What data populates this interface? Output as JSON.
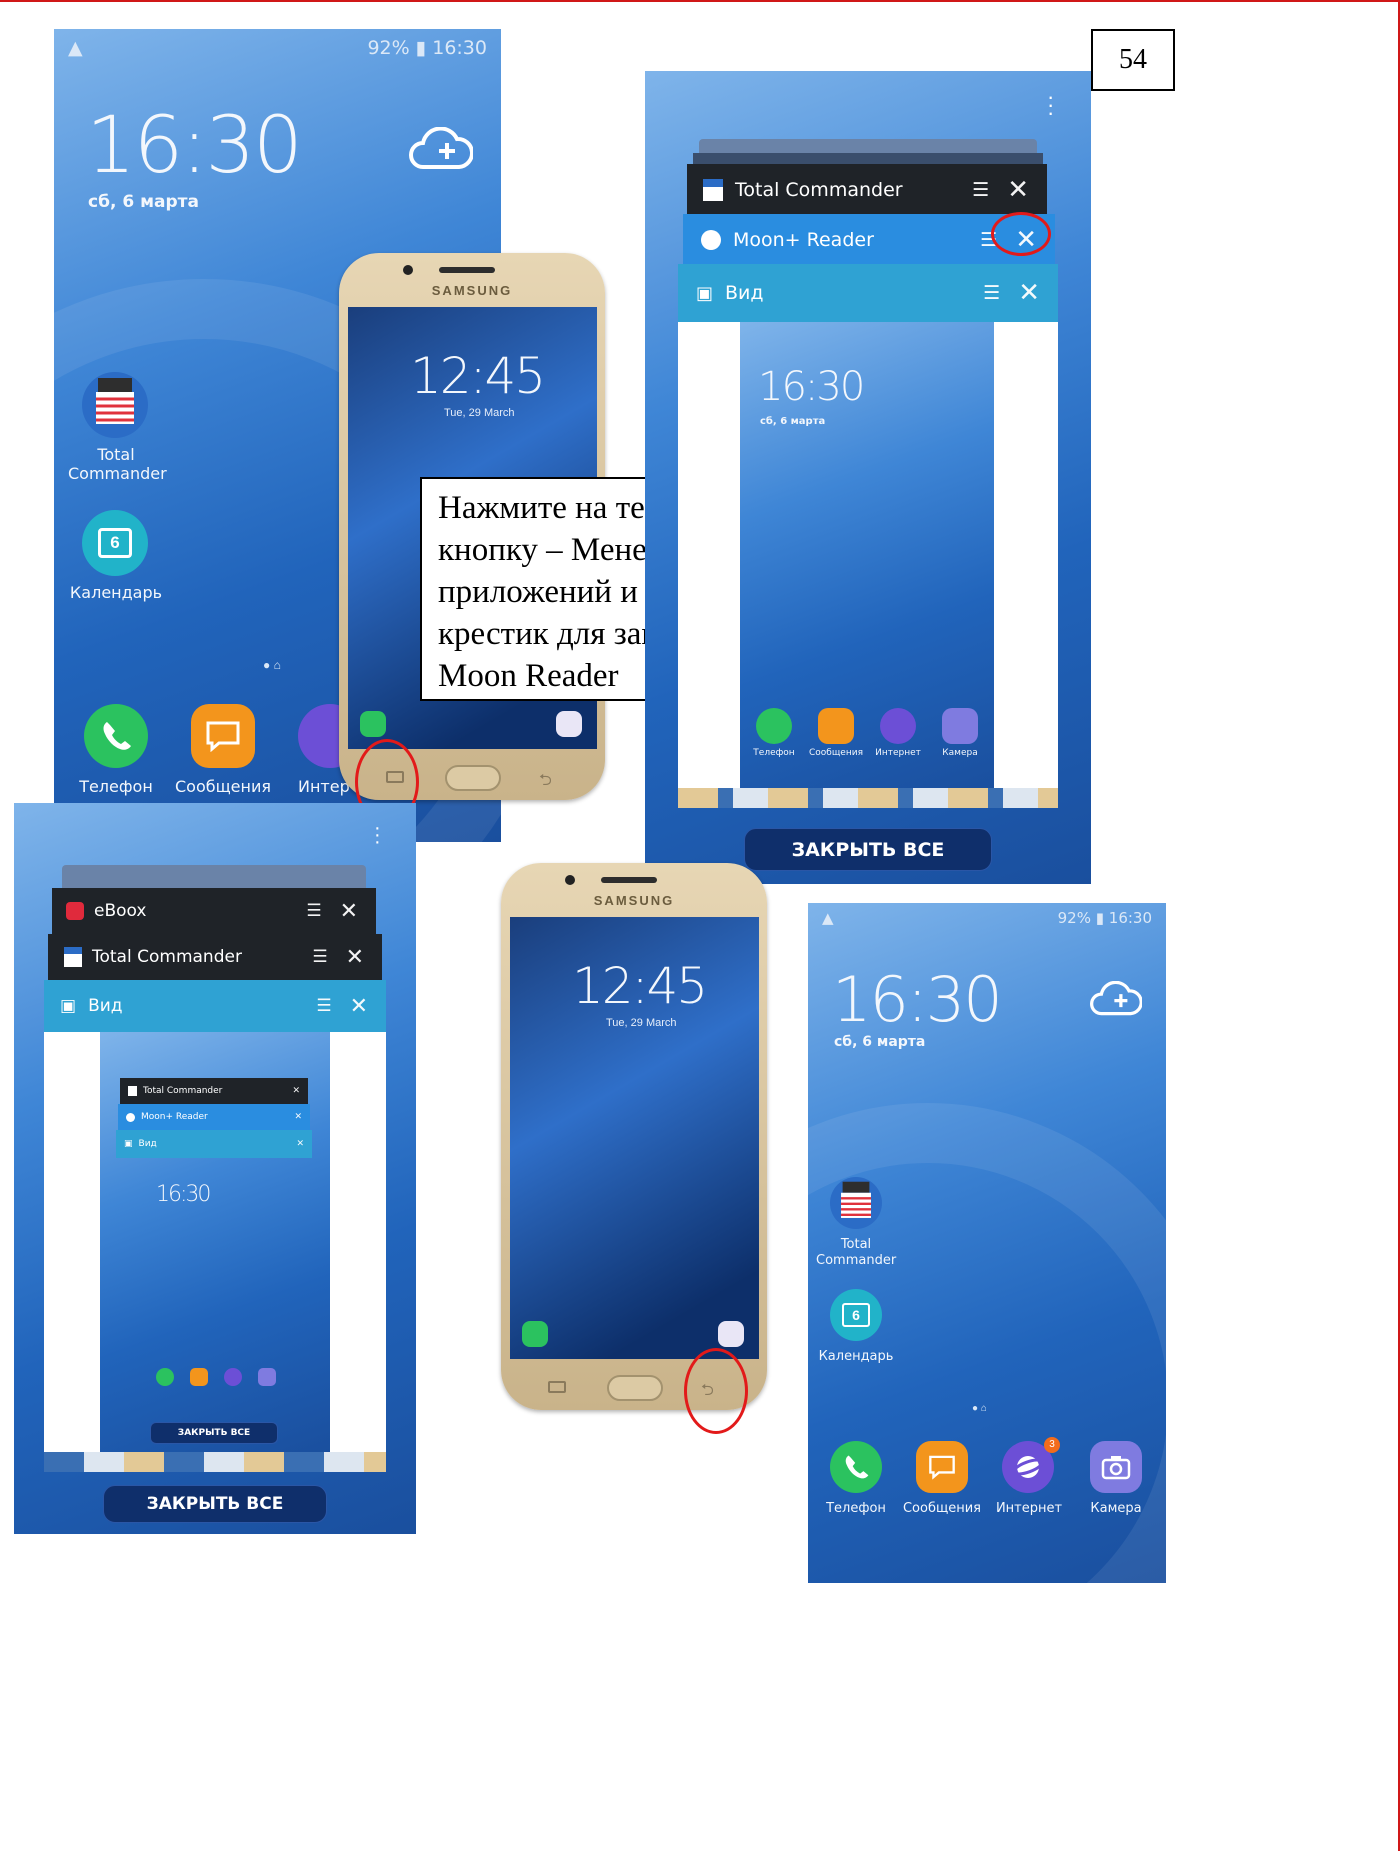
{
  "page_number": "54",
  "instruction": "Нажмите на телефоне кнопку – Менеджер приложений и нажмите на крестик для закрытия – Moon Reader",
  "status": {
    "right": "92% ▮ 16:30",
    "left": "▲"
  },
  "home": {
    "time": "16:30",
    "date": "сб, 6 марта",
    "apps": {
      "total_commander": "Total Commander",
      "calendar": "Календарь",
      "calendar_day": "6"
    },
    "dock": {
      "phone": "Телефон",
      "messages": "Сообщения",
      "internet": "Интернет",
      "internet_cut": "Интер",
      "camera": "Камера"
    },
    "badge": "3"
  },
  "phone_mockup": {
    "brand": "SAMSUNG",
    "time": "12:45",
    "date": "Tue, 29 March"
  },
  "recents_top": {
    "cards": [
      "Total Commander",
      "Moon+ Reader",
      "Вид"
    ],
    "close_all": "ЗАКРЫТЬ ВСЕ"
  },
  "recents_bottom": {
    "cards": [
      "eBoox",
      "Total Commander",
      "Вид"
    ],
    "mini_cards": [
      "Total Commander",
      "Moon+ Reader",
      "Вид"
    ],
    "close_all": "ЗАКРЫТЬ ВСЕ"
  }
}
